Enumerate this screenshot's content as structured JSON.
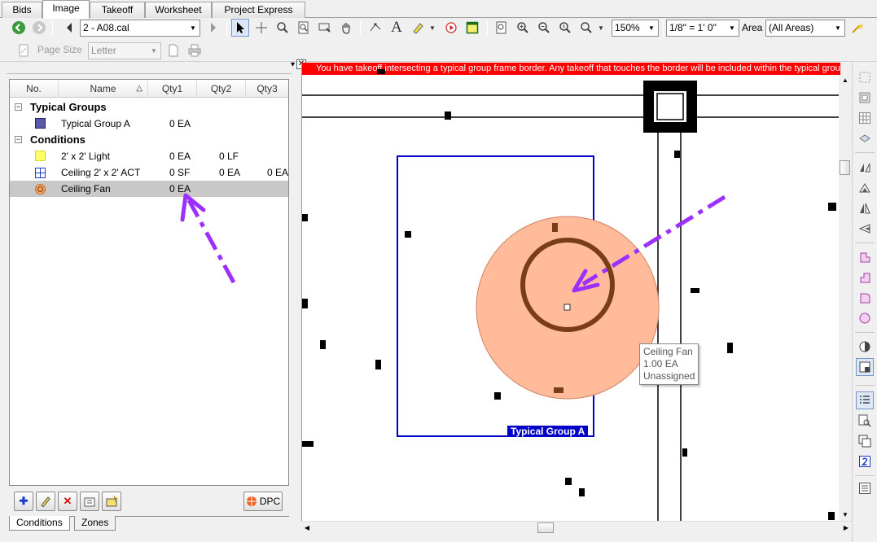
{
  "tabs": [
    {
      "label": "Bids"
    },
    {
      "label": "Image"
    },
    {
      "label": "Takeoff"
    },
    {
      "label": "Worksheet"
    },
    {
      "label": "Project Express"
    }
  ],
  "toolbar": {
    "page_select": "2 - A08.cal",
    "zoom": "150%",
    "scale": "1/8\" = 1' 0\"",
    "area_label": "Area",
    "area_select": "(All Areas)",
    "text_tool_glyph": "A",
    "page_size_label": "Page Size",
    "page_size_value": "Letter"
  },
  "panel": {
    "columns": [
      "No.",
      "Name",
      "Qty1",
      "Qty2",
      "Qty3"
    ],
    "groups": [
      {
        "label": "Typical Groups",
        "expander": "−",
        "items": [
          {
            "name": "Typical Group A",
            "qty1": "0 EA",
            "qty2": "",
            "qty3": "",
            "icon": "typical-group-icon",
            "color": "#5a5aa8"
          }
        ]
      },
      {
        "label": "Conditions",
        "expander": "−",
        "items": [
          {
            "name": "2' x 2' Light",
            "qty1": "0 EA",
            "qty2": "0 LF",
            "qty3": "",
            "icon": "light-fixture-icon",
            "color": "#ffff66"
          },
          {
            "name": "Ceiling 2' x 2' ACT",
            "qty1": "0 SF",
            "qty2": "0 EA",
            "qty3": "0 EA",
            "icon": "ceiling-grid-icon",
            "color": "#1a3ccc"
          },
          {
            "name": "Ceiling Fan",
            "qty1": "0 EA",
            "qty2": "",
            "qty3": "",
            "icon": "ceiling-fan-icon",
            "color": "#f4a460"
          }
        ]
      }
    ],
    "dpc_label": "DPC",
    "bottom_tabs": [
      "Conditions",
      "Zones"
    ]
  },
  "canvas": {
    "banner": "You have takeoff intersecting a typical group frame border.  Any takeoff that touches the border will be included within the typical group.",
    "group_label": "Typical Group A",
    "tooltip": [
      "Ceiling Fan",
      "1.00 EA",
      "Unassigned"
    ],
    "fan_fill": "#ffbb9a",
    "fan_ring": "#7a3d1a",
    "group_frame": "#0000c8",
    "annotation_arrow": "#9b30ff"
  }
}
